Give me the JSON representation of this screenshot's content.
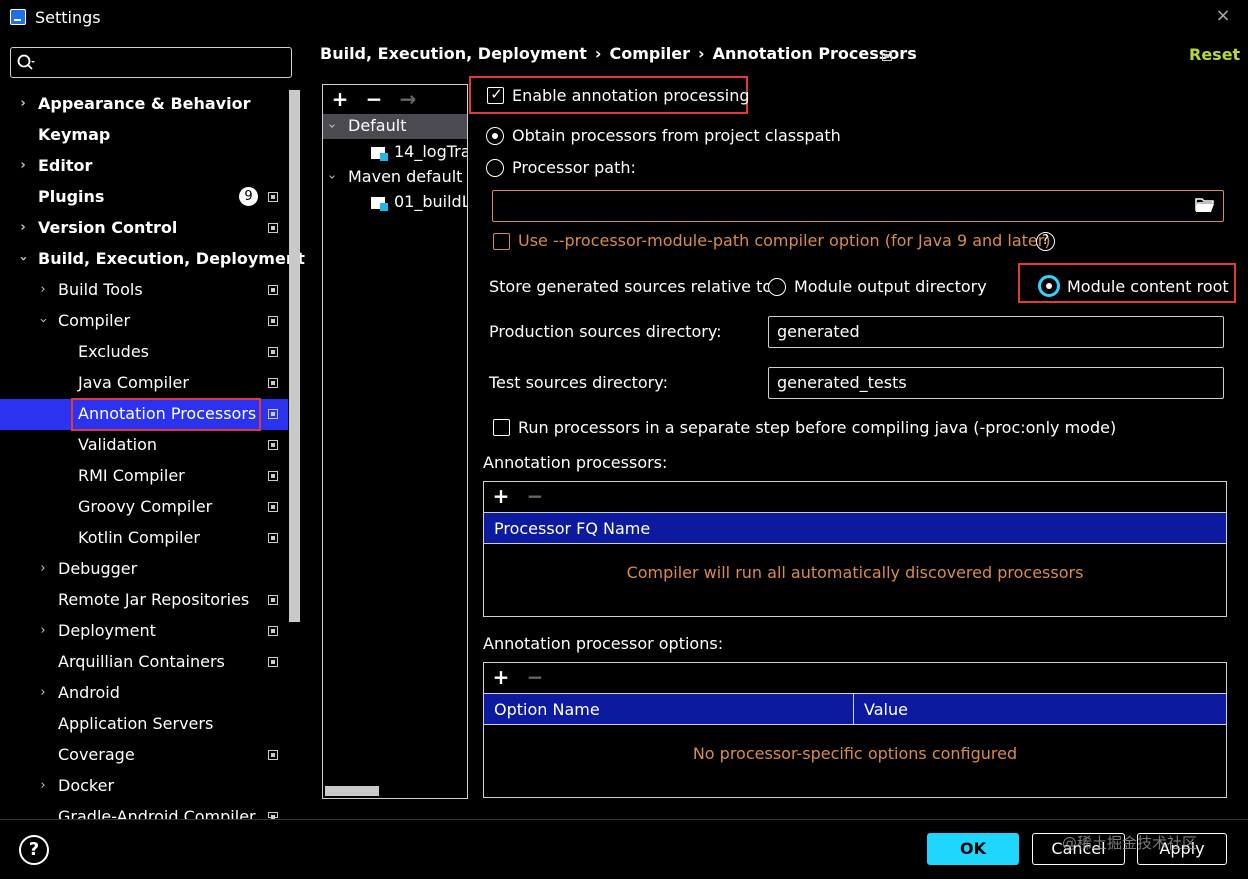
{
  "window": {
    "title": "Settings",
    "close_icon": "×"
  },
  "search": {
    "value": "",
    "placeholder": ""
  },
  "sidebar": {
    "items": [
      {
        "label": "Appearance & Behavior"
      },
      {
        "label": "Keymap"
      },
      {
        "label": "Editor"
      },
      {
        "label": "Plugins",
        "badge": "9"
      },
      {
        "label": "Version Control"
      },
      {
        "label": "Build, Execution, Deployment"
      },
      {
        "label": "Build Tools"
      },
      {
        "label": "Compiler"
      },
      {
        "label": "Excludes"
      },
      {
        "label": "Java Compiler"
      },
      {
        "label": "Annotation Processors"
      },
      {
        "label": "Validation"
      },
      {
        "label": "RMI Compiler"
      },
      {
        "label": "Groovy Compiler"
      },
      {
        "label": "Kotlin Compiler"
      },
      {
        "label": "Debugger"
      },
      {
        "label": "Remote Jar Repositories"
      },
      {
        "label": "Deployment"
      },
      {
        "label": "Arquillian Containers"
      },
      {
        "label": "Android"
      },
      {
        "label": "Application Servers"
      },
      {
        "label": "Coverage"
      },
      {
        "label": "Docker"
      },
      {
        "label": "Gradle-Android Compiler"
      }
    ]
  },
  "breadcrumb": {
    "part1": "Build, Execution, Deployment",
    "part2": "Compiler",
    "part3": "Annotation Processors",
    "sep": "›"
  },
  "reset_label": "Reset",
  "profiles": {
    "add": "+",
    "remove": "−",
    "move": "→",
    "items": [
      {
        "label": "Default"
      },
      {
        "label": "14_logTra"
      },
      {
        "label": "Maven default a"
      },
      {
        "label": "01_buildL"
      }
    ]
  },
  "settings": {
    "enable_label": "Enable annotation processing",
    "enable_checked": true,
    "obtain_label": "Obtain processors from project classpath",
    "processor_path_label": "Processor path:",
    "processor_path_value": "",
    "module_path_label": "Use --processor-module-path compiler option (for Java 9 and later)",
    "store_label": "Store generated sources relative to:",
    "module_output_label": "Module output directory",
    "module_content_label": "Module content root",
    "production_label": "Production sources directory:",
    "production_value": "generated",
    "test_label": "Test sources directory:",
    "test_value": "generated_tests",
    "run_separate_label": "Run processors in a separate step before compiling java (-proc:only mode)"
  },
  "processors_table": {
    "title": "Annotation processors:",
    "add": "+",
    "remove": "−",
    "column": "Processor FQ Name",
    "empty_text": "Compiler will run all automatically discovered processors"
  },
  "options_table": {
    "title": "Annotation processor options:",
    "add": "+",
    "remove": "−",
    "col1": "Option Name",
    "col2": "Value",
    "empty_text": "No processor-specific options configured"
  },
  "buttons": {
    "help": "?",
    "ok": "OK",
    "cancel": "Cancel",
    "apply": "Apply"
  },
  "watermark": "@稀土掘金技术社区",
  "colors": {
    "selection": "#2c33f0",
    "accent": "#1fd6ff",
    "warning": "#d98c4a",
    "link": "#b6d73c",
    "highlight_box": "#e23a3a"
  }
}
